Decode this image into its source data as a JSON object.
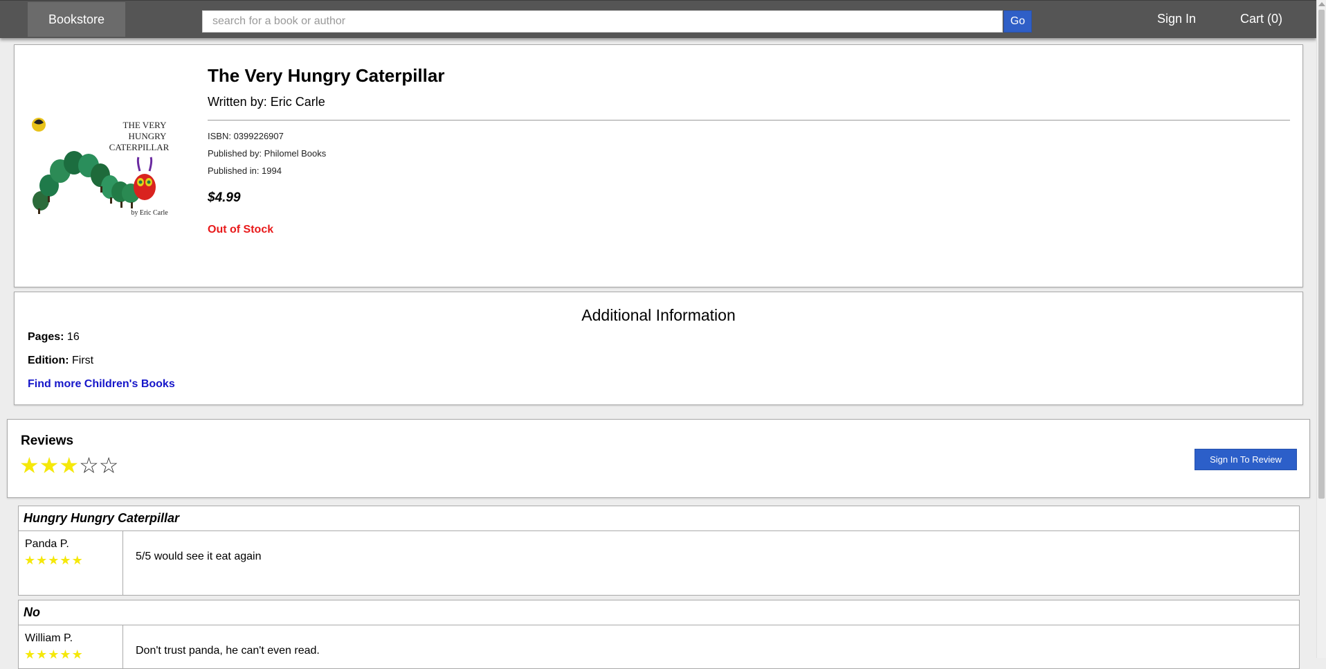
{
  "header": {
    "brand": "Bookstore",
    "search_placeholder": "search for a book or author",
    "search_value": "",
    "go_label": "Go",
    "signin_label": "Sign In",
    "cart_label": "Cart (0)"
  },
  "book": {
    "title": "The Very Hungry Caterpillar",
    "author_line": "Written by: Eric Carle",
    "cover_text_line1": "THE VERY",
    "cover_text_line2": "HUNGRY",
    "cover_text_line3": "CATERPILLAR",
    "cover_byline": "by Eric Carle",
    "isbn": "ISBN: 0399226907",
    "publisher": "Published by: Philomel Books",
    "year": "Published in: 1994",
    "price": "$4.99",
    "stock_status": "Out of Stock",
    "stock_color": "#e8191a"
  },
  "additional_info": {
    "heading": "Additional Information",
    "pages_label": "Pages:",
    "pages_value": "16",
    "edition_label": "Edition:",
    "edition_value": "First",
    "category_link": "Find more Children's Books"
  },
  "reviews": {
    "heading": "Reviews",
    "average_rating": 3,
    "max_rating": 5,
    "review_button_label": "Sign In To Review",
    "items": [
      {
        "title": "Hungry Hungry Caterpillar",
        "reviewer": "Panda P.",
        "rating": 5,
        "text": "5/5 would see it eat again"
      },
      {
        "title": "No",
        "reviewer": "William P.",
        "rating": 5,
        "text": "Don't trust panda, he can't even read."
      }
    ]
  },
  "colors": {
    "nav_background": "#555555",
    "accent_blue": "#2f5fc7",
    "star_yellow": "#f5e80a",
    "link_blue": "#1515c9"
  }
}
